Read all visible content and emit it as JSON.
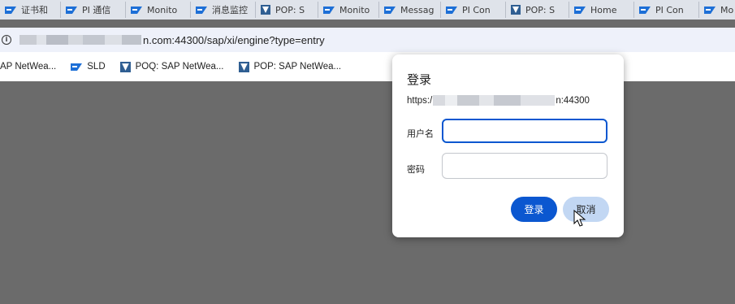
{
  "tabs": [
    {
      "label": "证书和",
      "icon": "sap-icon"
    },
    {
      "label": "PI 通信",
      "icon": "sap-icon"
    },
    {
      "label": "Monito",
      "icon": "sap-icon"
    },
    {
      "label": "消息监控",
      "icon": "sap-icon"
    },
    {
      "label": "POP: S",
      "icon": "sap-portal-icon"
    },
    {
      "label": "Monito",
      "icon": "sap-icon"
    },
    {
      "label": "Messag",
      "icon": "sap-icon"
    },
    {
      "label": "PI Con",
      "icon": "sap-icon"
    },
    {
      "label": "POP: S",
      "icon": "sap-portal-icon"
    },
    {
      "label": "Home",
      "icon": "sap-icon"
    },
    {
      "label": "PI Con",
      "icon": "sap-icon"
    },
    {
      "label": "Mo",
      "icon": "sap-icon"
    }
  ],
  "address": {
    "url_visible": "n.com:44300/sap/xi/engine?type=entry",
    "icon": "info-icon"
  },
  "bookmarks": [
    {
      "label": "AP NetWea...",
      "icon": "none"
    },
    {
      "label": "SLD",
      "icon": "sap-icon"
    },
    {
      "label": "POQ: SAP NetWea...",
      "icon": "sap-portal-icon"
    },
    {
      "label": "POP: SAP NetWea...",
      "icon": "sap-portal-icon"
    }
  ],
  "dialog": {
    "title": "登录",
    "origin_prefix": "https:/",
    "origin_suffix": "n:44300",
    "username_label": "用户名",
    "password_label": "密码",
    "username_value": "",
    "password_value": "",
    "login_button": "登录",
    "cancel_button": "取消"
  },
  "colors": {
    "primary": "#0b57d0",
    "cancel_bg": "#c2d7f3",
    "overlay": "#6b6b6b",
    "sap_blue": "#1d6fd6"
  }
}
